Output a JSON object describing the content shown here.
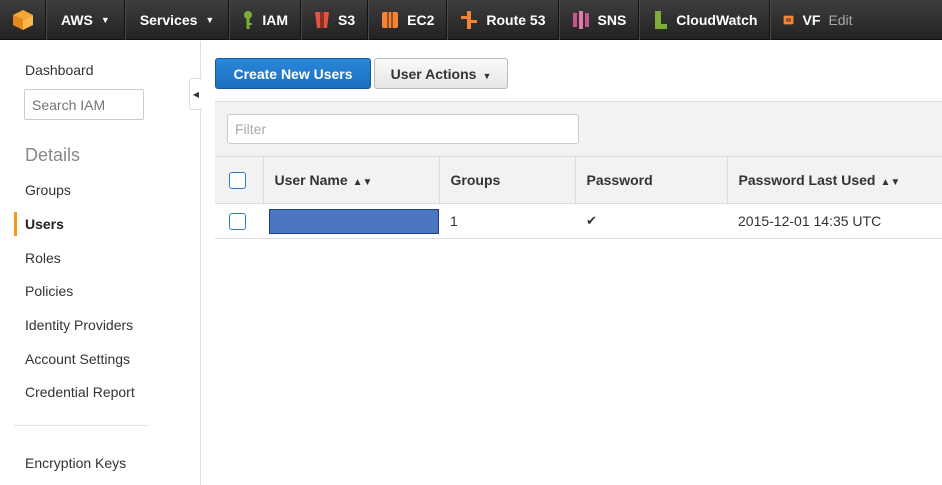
{
  "topbar": {
    "brand_label": "AWS",
    "services_label": "Services",
    "services": [
      {
        "label": "IAM",
        "icon": "iam-key-icon",
        "color": "#7dad39"
      },
      {
        "label": "S3",
        "icon": "s3-bucket-icon",
        "color": "#e25444"
      },
      {
        "label": "EC2",
        "icon": "ec2-instance-icon",
        "color": "#f58536"
      },
      {
        "label": "Route 53",
        "icon": "route53-icon",
        "color": "#f58536"
      },
      {
        "label": "SNS",
        "icon": "sns-icon",
        "color": "#c7578b"
      },
      {
        "label": "CloudWatch",
        "icon": "cloudwatch-icon",
        "color": "#7dad39"
      },
      {
        "label": "VF",
        "icon": "vpc-icon",
        "color": "#f58536"
      }
    ],
    "edit_label": "Edit"
  },
  "sidebar": {
    "dashboard": "Dashboard",
    "search_placeholder": "Search IAM",
    "section_title": "Details",
    "items": [
      {
        "label": "Groups",
        "active": false
      },
      {
        "label": "Users",
        "active": true
      },
      {
        "label": "Roles",
        "active": false
      },
      {
        "label": "Policies",
        "active": false
      },
      {
        "label": "Identity Providers",
        "active": false
      },
      {
        "label": "Account Settings",
        "active": false
      },
      {
        "label": "Credential Report",
        "active": false
      }
    ],
    "footer_item": "Encryption Keys",
    "active_color": "#f39c12"
  },
  "toolbar": {
    "create_label": "Create New Users",
    "actions_label": "User Actions"
  },
  "filter": {
    "placeholder": "Filter"
  },
  "table": {
    "columns": [
      "User Name",
      "Groups",
      "Password",
      "Password Last Used"
    ],
    "rows": [
      {
        "user_name": "",
        "user_name_redacted": true,
        "groups": "1",
        "password": "✔",
        "password_last_used": "2015-12-01 14:35 UTC"
      }
    ]
  },
  "colors": {
    "accent": "#1a6fc0",
    "topbar": "#2b2b2b"
  }
}
